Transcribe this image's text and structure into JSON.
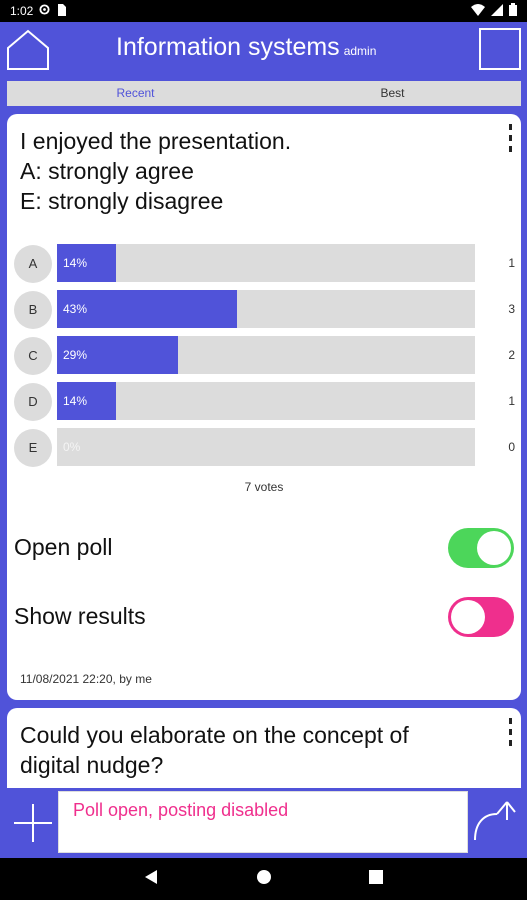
{
  "status_bar": {
    "time": "1:02"
  },
  "header": {
    "title": "Information systems",
    "user": "admin"
  },
  "tabs": [
    {
      "label": "Recent",
      "active": true
    },
    {
      "label": "Best",
      "active": false
    }
  ],
  "poll": {
    "question_lines": [
      "I enjoyed the presentation.",
      "A: strongly agree",
      "E: strongly disagree"
    ],
    "options": [
      {
        "letter": "A",
        "percent_label": "14%",
        "percent": 14,
        "count": "1"
      },
      {
        "letter": "B",
        "percent_label": "43%",
        "percent": 43,
        "count": "3"
      },
      {
        "letter": "C",
        "percent_label": "29%",
        "percent": 29,
        "count": "2"
      },
      {
        "letter": "D",
        "percent_label": "14%",
        "percent": 14,
        "count": "1"
      },
      {
        "letter": "E",
        "percent_label": "0%",
        "percent": 0,
        "count": "0"
      }
    ],
    "votes_label": "7 votes",
    "open_poll": {
      "label": "Open poll",
      "on": true
    },
    "show_results": {
      "label": "Show results",
      "on": false
    },
    "meta": "11/08/2021 22:20, by me"
  },
  "next_question": {
    "lines": [
      "Could you elaborate on the concept of",
      "digital nudge?"
    ]
  },
  "composer": {
    "placeholder": "Poll open, posting disabled"
  },
  "colors": {
    "accent": "#5053d9",
    "toggle_on": "#4cd65a",
    "toggle_pink": "#ef2f8d",
    "track": "#dcdcdc"
  },
  "icons": [
    "home-icon",
    "square-icon",
    "kebab-icon",
    "plus-icon",
    "send-icon",
    "back-icon",
    "home-nav-icon",
    "recents-icon"
  ]
}
